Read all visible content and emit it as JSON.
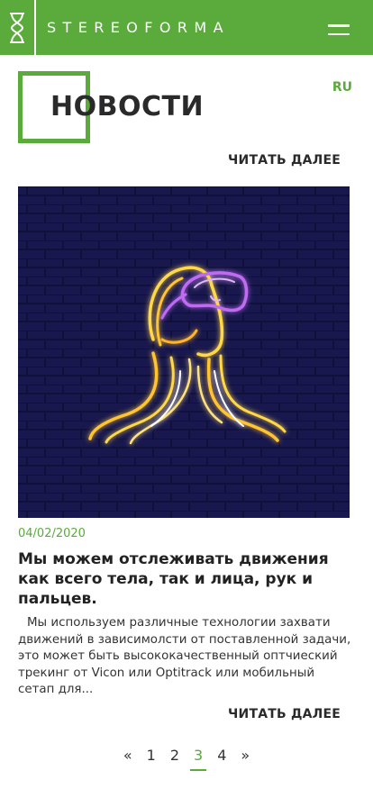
{
  "header": {
    "brand": "STEREOFORMA",
    "logo_icon": "hourglass-logo-icon",
    "menu_icon": "hamburger-menu-icon",
    "accent_color": "#5aaa3c"
  },
  "page": {
    "title": "НОВОСТИ",
    "language": "RU",
    "read_more_top": "ЧИТАТЬ ДАЛЕЕ"
  },
  "article": {
    "image_subject": "neon-vr-headset-head-icon",
    "date": "04/02/2020",
    "title": "Мы можем отслеживать движения как всего тела, так и лица, рук и пальцев.",
    "text": "Мы используем различные технологии захвати движений в зависимолсти от поставленной задачи, это может быть высококачественный оптчиеский трекинг от Vicon или Optitrack или мобильный сетап для...",
    "read_more": "ЧИТАТЬ ДАЛЕЕ"
  },
  "pagination": {
    "prev": "«",
    "pages": [
      "1",
      "2",
      "3",
      "4"
    ],
    "active_page": "3",
    "next": "»"
  }
}
